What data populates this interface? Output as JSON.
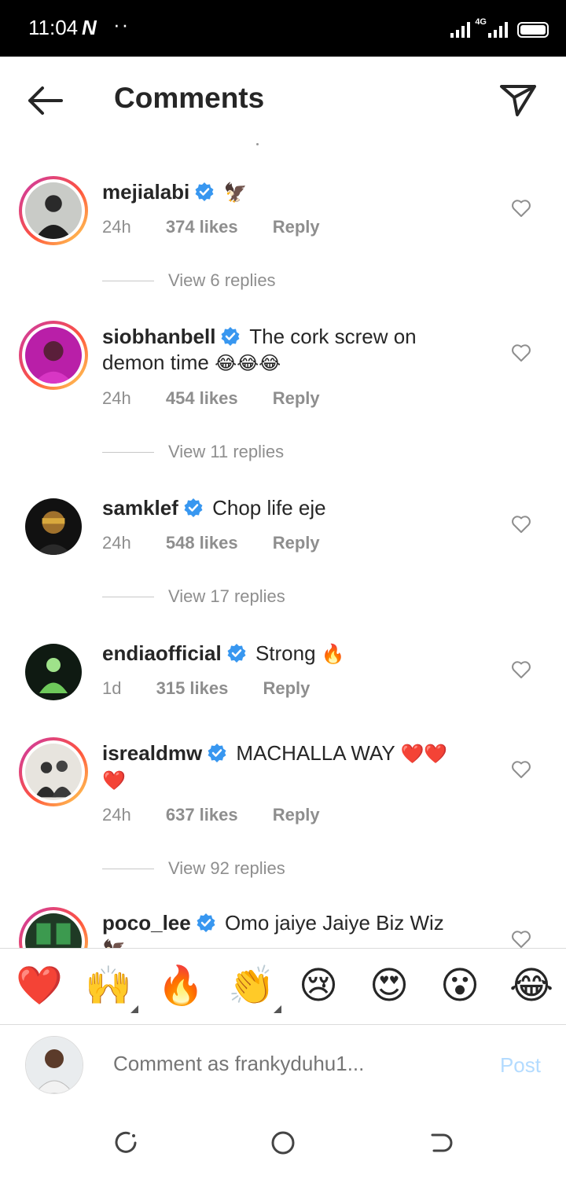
{
  "status": {
    "time": "11:04",
    "network_type": "4G"
  },
  "header": {
    "title": "Comments"
  },
  "comments": [
    {
      "username": "mejialabi",
      "text": "",
      "emoji": "🦅",
      "time": "24h",
      "likes": "374 likes",
      "reply": "Reply",
      "view_replies": "View 6 replies"
    },
    {
      "username": "siobhanbell",
      "text": "The cork screw on",
      "text2": "demon time",
      "emoji": "😂😂😂",
      "time": "24h",
      "likes": "454 likes",
      "reply": "Reply",
      "view_replies": "View 11 replies"
    },
    {
      "username": "samklef",
      "text": "Chop life eje",
      "time": "24h",
      "likes": "548 likes",
      "reply": "Reply",
      "view_replies": "View 17 replies"
    },
    {
      "username": "endiaofficial",
      "text": "Strong",
      "emoji": "🔥",
      "time": "1d",
      "likes": "315 likes",
      "reply": "Reply"
    },
    {
      "username": "isrealdmw",
      "text": "MACHALLA WAY",
      "emoji": "❤️❤️",
      "emoji2": "❤️",
      "time": "24h",
      "likes": "637 likes",
      "reply": "Reply",
      "view_replies": "View 92 replies"
    },
    {
      "username": "poco_lee",
      "text": "Omo jaiye Jaiye Biz Wiz",
      "emoji2": "🦅"
    }
  ],
  "emoji_bar": [
    "❤️",
    "🙌",
    "🔥",
    "👏",
    "😢",
    "😍",
    "😮",
    "😂"
  ],
  "composer": {
    "placeholder": "Comment as frankyduhu1...",
    "post": "Post"
  },
  "icons": {
    "back": "arrow-left-icon",
    "dm": "send-icon",
    "like": "heart-outline-icon",
    "verified": "verified-badge-icon",
    "nav": [
      "recents-icon",
      "home-icon",
      "back-nav-icon"
    ]
  },
  "colors": {
    "verified": "#3897f0",
    "post_disabled": "#b3dbff",
    "muted": "#8e8e8e"
  }
}
